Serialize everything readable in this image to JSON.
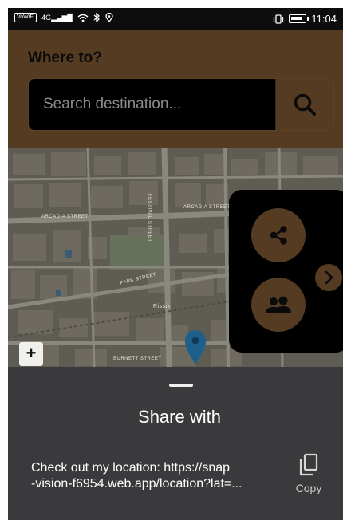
{
  "status_bar": {
    "network": "4G",
    "time": "11:04"
  },
  "header": {
    "title": "Where to?",
    "search_placeholder": "Search destination..."
  },
  "map": {
    "street_labels": [
      "ARCADIA STREET",
      "ARCADIA STREET",
      "FESTIVAL STREET",
      "PARK STREET",
      "BURNETT STREET"
    ],
    "place_label": "Rissik",
    "zoom_in_label": "+"
  },
  "share_sheet": {
    "title": "Share with",
    "message_line1": "Check out my location: https://snap",
    "message_line2": "-vision-f6954.web.app/location?lat=...",
    "copy_label": "Copy"
  },
  "colors": {
    "accent_brown": "#543b22",
    "sheet_bg": "#3a3a3c",
    "pin_blue": "#1f5f8b"
  }
}
